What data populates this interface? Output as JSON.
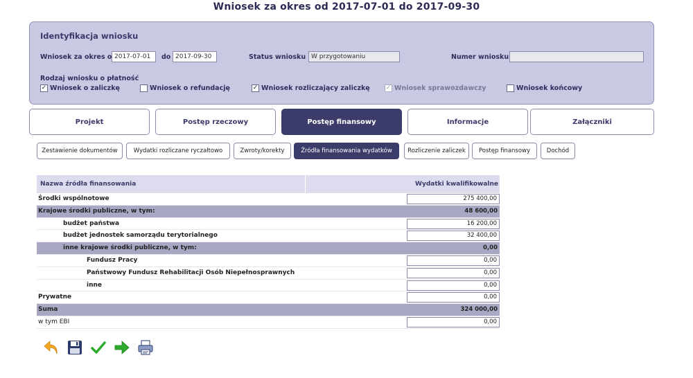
{
  "page": {
    "title": "Wniosek za okres od 2017-07-01 do 2017-09-30"
  },
  "identification": {
    "title": "Identyfikacja wniosku",
    "period_from_label": "Wniosek za okres od",
    "period_from_value": "2017-07-01",
    "period_to_label": "do",
    "period_to_value": "2017-09-30",
    "status_label": "Status wniosku",
    "status_value": "W przygotowaniu",
    "number_label": "Numer wniosku",
    "number_value": "",
    "type_label": "Rodzaj wniosku o płatność",
    "types": [
      {
        "label": "Wniosek o zaliczkę",
        "checked": "✓"
      },
      {
        "label": "Wniosek o refundację",
        "checked": ""
      },
      {
        "label": "Wniosek rozliczający zaliczkę",
        "checked": "✓"
      },
      {
        "label": "Wniosek sprawozdawczy",
        "checked": "✓"
      },
      {
        "label": "Wniosek końcowy",
        "checked": ""
      }
    ]
  },
  "main_tabs": [
    "Projekt",
    "Postęp rzeczowy",
    "Postęp finansowy",
    "Informacje",
    "Załączniki"
  ],
  "sub_tabs": [
    "Zestawienie dokumentów",
    "Wydatki rozliczane ryczałtowo",
    "Zwroty/korekty",
    "Źródła finansowania wydatków",
    "Rozliczenie zaliczek",
    "Postęp finansowy",
    "Dochód"
  ],
  "table": {
    "col_name": "Nazwa źródła finansowania",
    "col_value": "Wydatki kwalifikowalne",
    "rows": [
      {
        "name": "Środki wspólnotowe",
        "value": "275 400,00"
      },
      {
        "name": "Krajowe środki publiczne, w tym:",
        "value": "48 600,00"
      },
      {
        "name": "budżet państwa",
        "value": "16 200,00"
      },
      {
        "name": "budżet jednostek samorządu terytorialnego",
        "value": "32 400,00"
      },
      {
        "name": "inne krajowe środki publiczne, w tym:",
        "value": "0,00"
      },
      {
        "name": "Fundusz Pracy",
        "value": "0,00"
      },
      {
        "name": "Państwowy Fundusz Rehabilitacji Osób Niepełnosprawnych",
        "value": "0,00"
      },
      {
        "name": "inne",
        "value": "0,00"
      },
      {
        "name": "Prywatne",
        "value": "0,00"
      },
      {
        "name": "Suma",
        "value": "324 000,00"
      },
      {
        "name": "w tym EBI",
        "value": "0,00"
      }
    ]
  },
  "toolbar": {
    "icons": [
      "back-arrow-icon",
      "save-icon",
      "check-icon",
      "forward-arrow-icon",
      "print-icon"
    ]
  },
  "colors": {
    "panel_bg": "#c9c9e4",
    "active_tab": "#3c3c6a",
    "header_gray": "#a8a8c4",
    "back_arrow": "#f5a623",
    "check": "#2eaa2e",
    "forward_arrow": "#2eaa2e"
  }
}
